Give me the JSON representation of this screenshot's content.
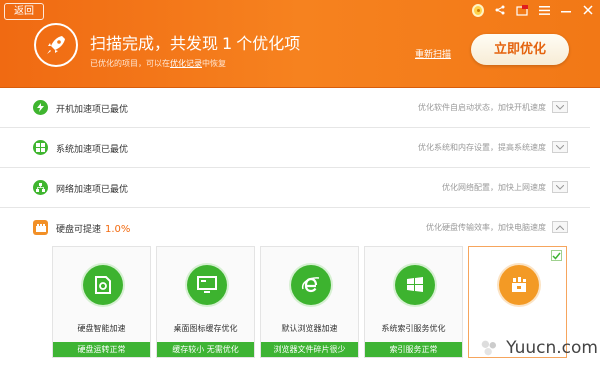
{
  "header": {
    "back_label": "返回",
    "title_prefix": "扫描完成，共发现",
    "title_count": "1",
    "title_suffix": "个优化项",
    "sub_prefix": "已优化的项目，可以在",
    "sub_link": "优化记录",
    "sub_suffix": "中恢复",
    "rescan_label": "重新扫描",
    "optimize_label": "立即优化",
    "accent_color": "#f27816"
  },
  "rows": [
    {
      "label": "开机加速项已最优",
      "desc": "优化软件自启动状态，加快开机速度",
      "icon": "power-icon"
    },
    {
      "label": "系统加速项已最优",
      "desc": "优化系统和内存设置，提高系统速度",
      "icon": "windows-icon"
    },
    {
      "label": "网络加速项已最优",
      "desc": "优化网络配置，加快上网速度",
      "icon": "network-icon"
    },
    {
      "label": "硬盘可提速",
      "pct": "1.0%",
      "desc": "优化硬盘传输效率，加快电脑速度",
      "icon": "disk-icon"
    }
  ],
  "cards": [
    {
      "name": "硬盘智能加速",
      "status": "硬盘运转正常",
      "icon": "disk-accel-icon"
    },
    {
      "name": "桌面图标缓存优化",
      "status": "缓存较小 无需优化",
      "icon": "monitor-icon"
    },
    {
      "name": "默认浏览器加速",
      "status": "浏览器文件碎片很少",
      "icon": "browser-icon"
    },
    {
      "name": "系统索引服务优化",
      "status": "索引服务正常",
      "icon": "windows-icon"
    },
    {
      "name": "",
      "status": "",
      "icon": "puzzle-icon"
    }
  ],
  "watermark": {
    "text": "Yuucn.com"
  }
}
